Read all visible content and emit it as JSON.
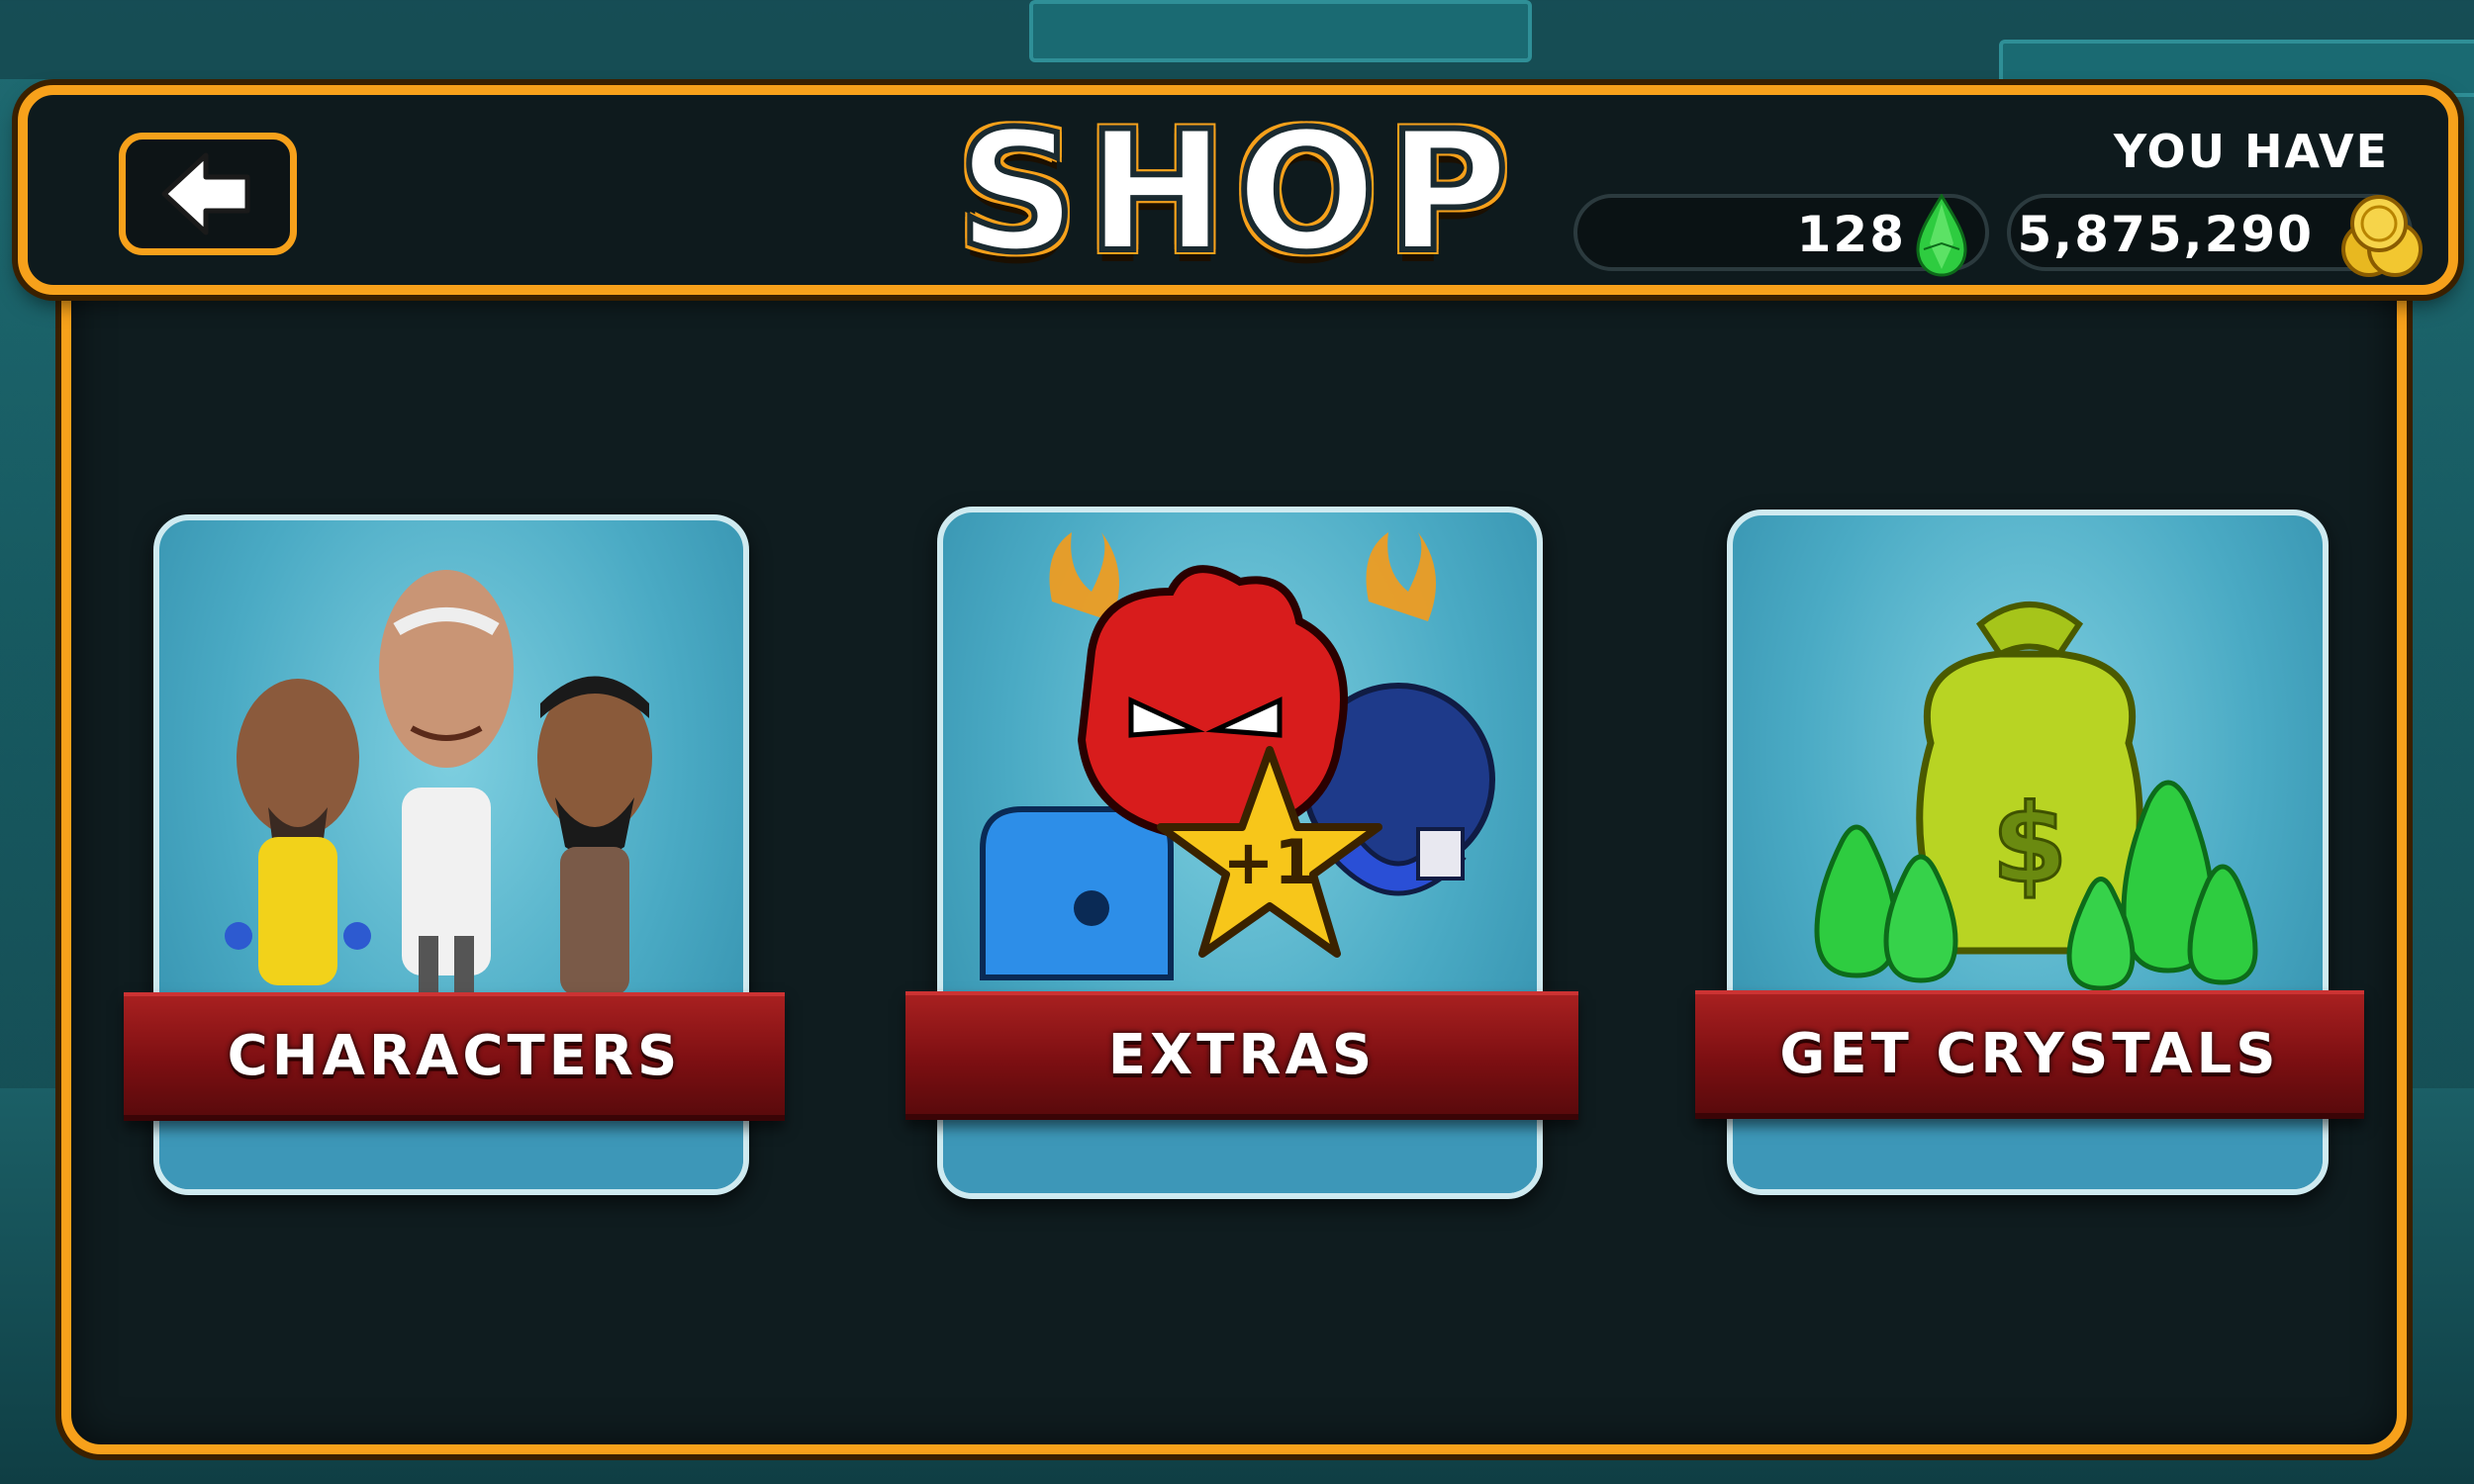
{
  "header": {
    "title": "SHOP",
    "you_have_label": "YOU HAVE",
    "crystals": "128",
    "coins": "5,875,290"
  },
  "cards": [
    {
      "label": "CHARACTERS"
    },
    {
      "label": "EXTRAS",
      "star_badge": "+1"
    },
    {
      "label": "GET CRYSTALS"
    }
  ],
  "colors": {
    "frame_orange": "#f7a11b",
    "panel_dark": "#0f1c1f",
    "card_blue": "#4aaac4",
    "ribbon_red": "#7d0f12",
    "crystal_green": "#2ecc40",
    "coin_gold": "#e8b820"
  },
  "icons": [
    "back-arrow-icon",
    "crystal-icon",
    "coin-stack-icon",
    "money-bag-icon"
  ]
}
